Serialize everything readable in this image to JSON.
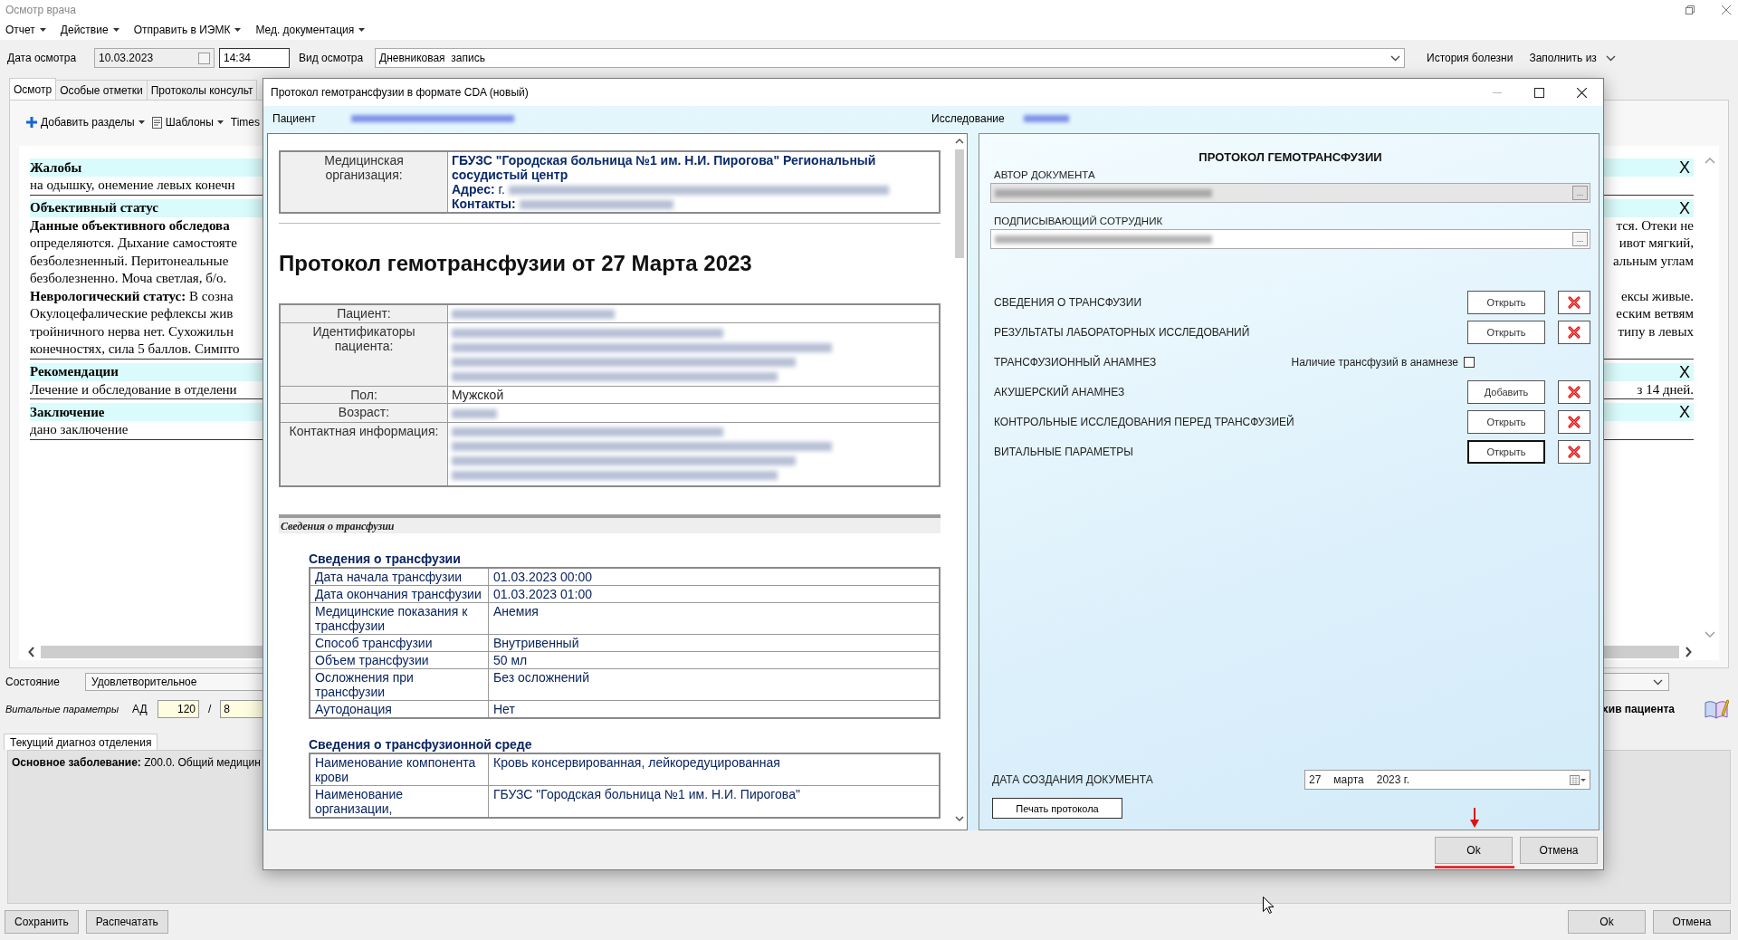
{
  "window": {
    "title": "Осмотр врача"
  },
  "menu": [
    {
      "label": "Отчет"
    },
    {
      "label": "Действие"
    },
    {
      "label": "Отправить в ИЭМК"
    },
    {
      "label": "Мед. документация"
    }
  ],
  "exam_bar": {
    "date_label": "Дата осмотра",
    "date": "10.03.2023",
    "time": "14:34",
    "type_label": "Вид осмотра",
    "type": "Дневниковая  запись",
    "history": "История болезни",
    "fill_from": "Заполнить из"
  },
  "tabs": [
    {
      "label": "Осмотр",
      "selected": true
    },
    {
      "label": "Особые отметки",
      "selected": false
    },
    {
      "label": "Протоколы консульт",
      "selected": false
    }
  ],
  "toolbar": [
    {
      "label": "Добавить разделы",
      "kind": "add"
    },
    {
      "label": "Шаблоны",
      "kind": "templates"
    },
    {
      "label": "Times",
      "kind": "font"
    }
  ],
  "exam_text": [
    {
      "title": "Жалобы",
      "close": "X",
      "lines": [
        {
          "left": "на одышку, онемение левых конечн"
        }
      ]
    },
    {
      "title": "Объективный статус",
      "close": "X",
      "lines": [
        {
          "left": "**Данные объективного обследова**",
          "right": "тся. Отеки не"
        },
        {
          "left": "определяются. Дыхание самостояте",
          "right": "ивот мягкий,"
        },
        {
          "left": "безболезненный. Перитонеальные",
          "right": "альным углам"
        },
        {
          "left": "безболезненно. Моча светлая, б/о."
        },
        {
          "left": "**Неврологический статус:** В созна",
          "right": "ексы живые."
        },
        {
          "left": "Окулоцефалические рефлексы жив",
          "right": "еским ветвям"
        },
        {
          "left": "тройничного нерва нет. Сухожильн",
          "right": "типу в левых"
        },
        {
          "left": "конечностях, сила 5 баллов. Симпто"
        }
      ]
    },
    {
      "title": "Рекомендации",
      "close": "X",
      "lines": [
        {
          "left": "Лечение и обследование в отделени",
          "right": "з 14 дней."
        }
      ]
    },
    {
      "title": "Заключение",
      "close": "X",
      "lines": [
        {
          "left": "дано заключение"
        }
      ]
    }
  ],
  "status": {
    "label": "Состояние",
    "value": "Удовлетворительное"
  },
  "vitals": {
    "label": "Витальные параметры",
    "bp_label": "АД",
    "systolic": "120",
    "separator": "/",
    "diastolic": "8",
    "archive": "хив пациента"
  },
  "diagnosis": {
    "tab": "Текущий диагноз отделения",
    "text": "**Основное заболевание:** Z00.0. Общий медицин"
  },
  "footer_left": [
    "Сохранить",
    "Распечатать"
  ],
  "footer_right": [
    "Ok",
    "Отмена"
  ],
  "dialog": {
    "title": "Протокол гемотрансфузии в формате CDA (новый)",
    "patient_label": "Пациент",
    "study_label": "Исследование",
    "document": {
      "org_label": "Медицинская организация:",
      "org_name": "ГБУЗС \"Городская больница №1 им. Н.И. Пирогова\" Региональный сосудистый центр",
      "org_lines": [
        "**Адрес:** г.",
        "**Контакты:**"
      ],
      "title": "Протокол гемотрансфузии от 27 Марта 2023",
      "patient_rows": [
        {
          "label": "Пациент:",
          "kind": "blurred"
        },
        {
          "label": "Идентификаторы пациента:",
          "kind": "blurred_block"
        },
        {
          "label": "Пол:",
          "kind": "text",
          "value": "Мужской"
        },
        {
          "label": "Возраст:",
          "kind": "blurred"
        },
        {
          "label": "Контактная информация:",
          "kind": "blurred_block"
        }
      ],
      "section_bar": "Сведения о трансфузии",
      "tables": [
        {
          "title": "Сведения о трансфузии",
          "rows": [
            {
              "label": "Дата начала трансфузии",
              "value": "01.03.2023 00:00"
            },
            {
              "label": "Дата окончания трансфузии",
              "value": "01.03.2023 01:00"
            },
            {
              "label": "Медицинские показания к трансфузии",
              "value": "Анемия"
            },
            {
              "label": "Способ трансфузии",
              "value": "Внутривенный"
            },
            {
              "label": "Объем трансфузии",
              "value": "50 мл"
            },
            {
              "label": "Осложнения при трансфузии",
              "value": "Без осложнений"
            },
            {
              "label": "Аутодонация",
              "value": "Нет"
            }
          ]
        },
        {
          "title": "Сведения о трансфузионной среде",
          "rows": [
            {
              "label": "Наименование компонента крови",
              "value": "Кровь консервированная, лейкоредуцированная"
            },
            {
              "label": "Наименование организации,",
              "value": "ГБУЗС \"Городская больница №1 им. Н.И. Пирогова\""
            }
          ]
        }
      ]
    },
    "form": {
      "title": "ПРОТОКОЛ ГЕМОТРАНСФУЗИИ",
      "fields": [
        {
          "label": "АВТОР ДОКУМЕНТА",
          "button": "...",
          "disabled": true
        },
        {
          "label": "ПОДПИСЫВАЮЩИЙ СОТРУДНИК",
          "button": "...",
          "disabled": false
        }
      ],
      "sections": [
        {
          "label": "СВЕДЕНИЯ О ТРАНСФУЗИИ",
          "kind": "button",
          "button": "Открыть",
          "focused": false
        },
        {
          "label": "РЕЗУЛЬТАТЫ ЛАБОРАТОРНЫХ ИССЛЕДОВАНИЙ",
          "kind": "button",
          "button": "Открыть",
          "focused": false
        },
        {
          "label": "ТРАНСФУЗИОННЫЙ АНАМНЕЗ",
          "kind": "checkbox",
          "check_label": "Наличие трансфузий в анамнезе",
          "checked": false
        },
        {
          "label": "АКУШЕРСКИЙ АНАМНЕЗ",
          "kind": "button",
          "button": "Добавить",
          "focused": false
        },
        {
          "label": "КОНТРОЛЬНЫЕ ИССЛЕДОВАНИЯ ПЕРЕД ТРАНСФУЗИЕЙ",
          "kind": "button",
          "button": "Открыть",
          "focused": false
        },
        {
          "label": "ВИТАЛЬНЫЕ ПАРАМЕТРЫ",
          "kind": "button",
          "button": "Открыть",
          "focused": true
        }
      ],
      "date_label": "ДАТА СОЗДАНИЯ ДОКУМЕНТА",
      "date": {
        "day": "27",
        "month": "марта",
        "year": "2023 г."
      },
      "print": "Печать протокола"
    },
    "buttons": [
      "Ok",
      "Отмена"
    ]
  }
}
